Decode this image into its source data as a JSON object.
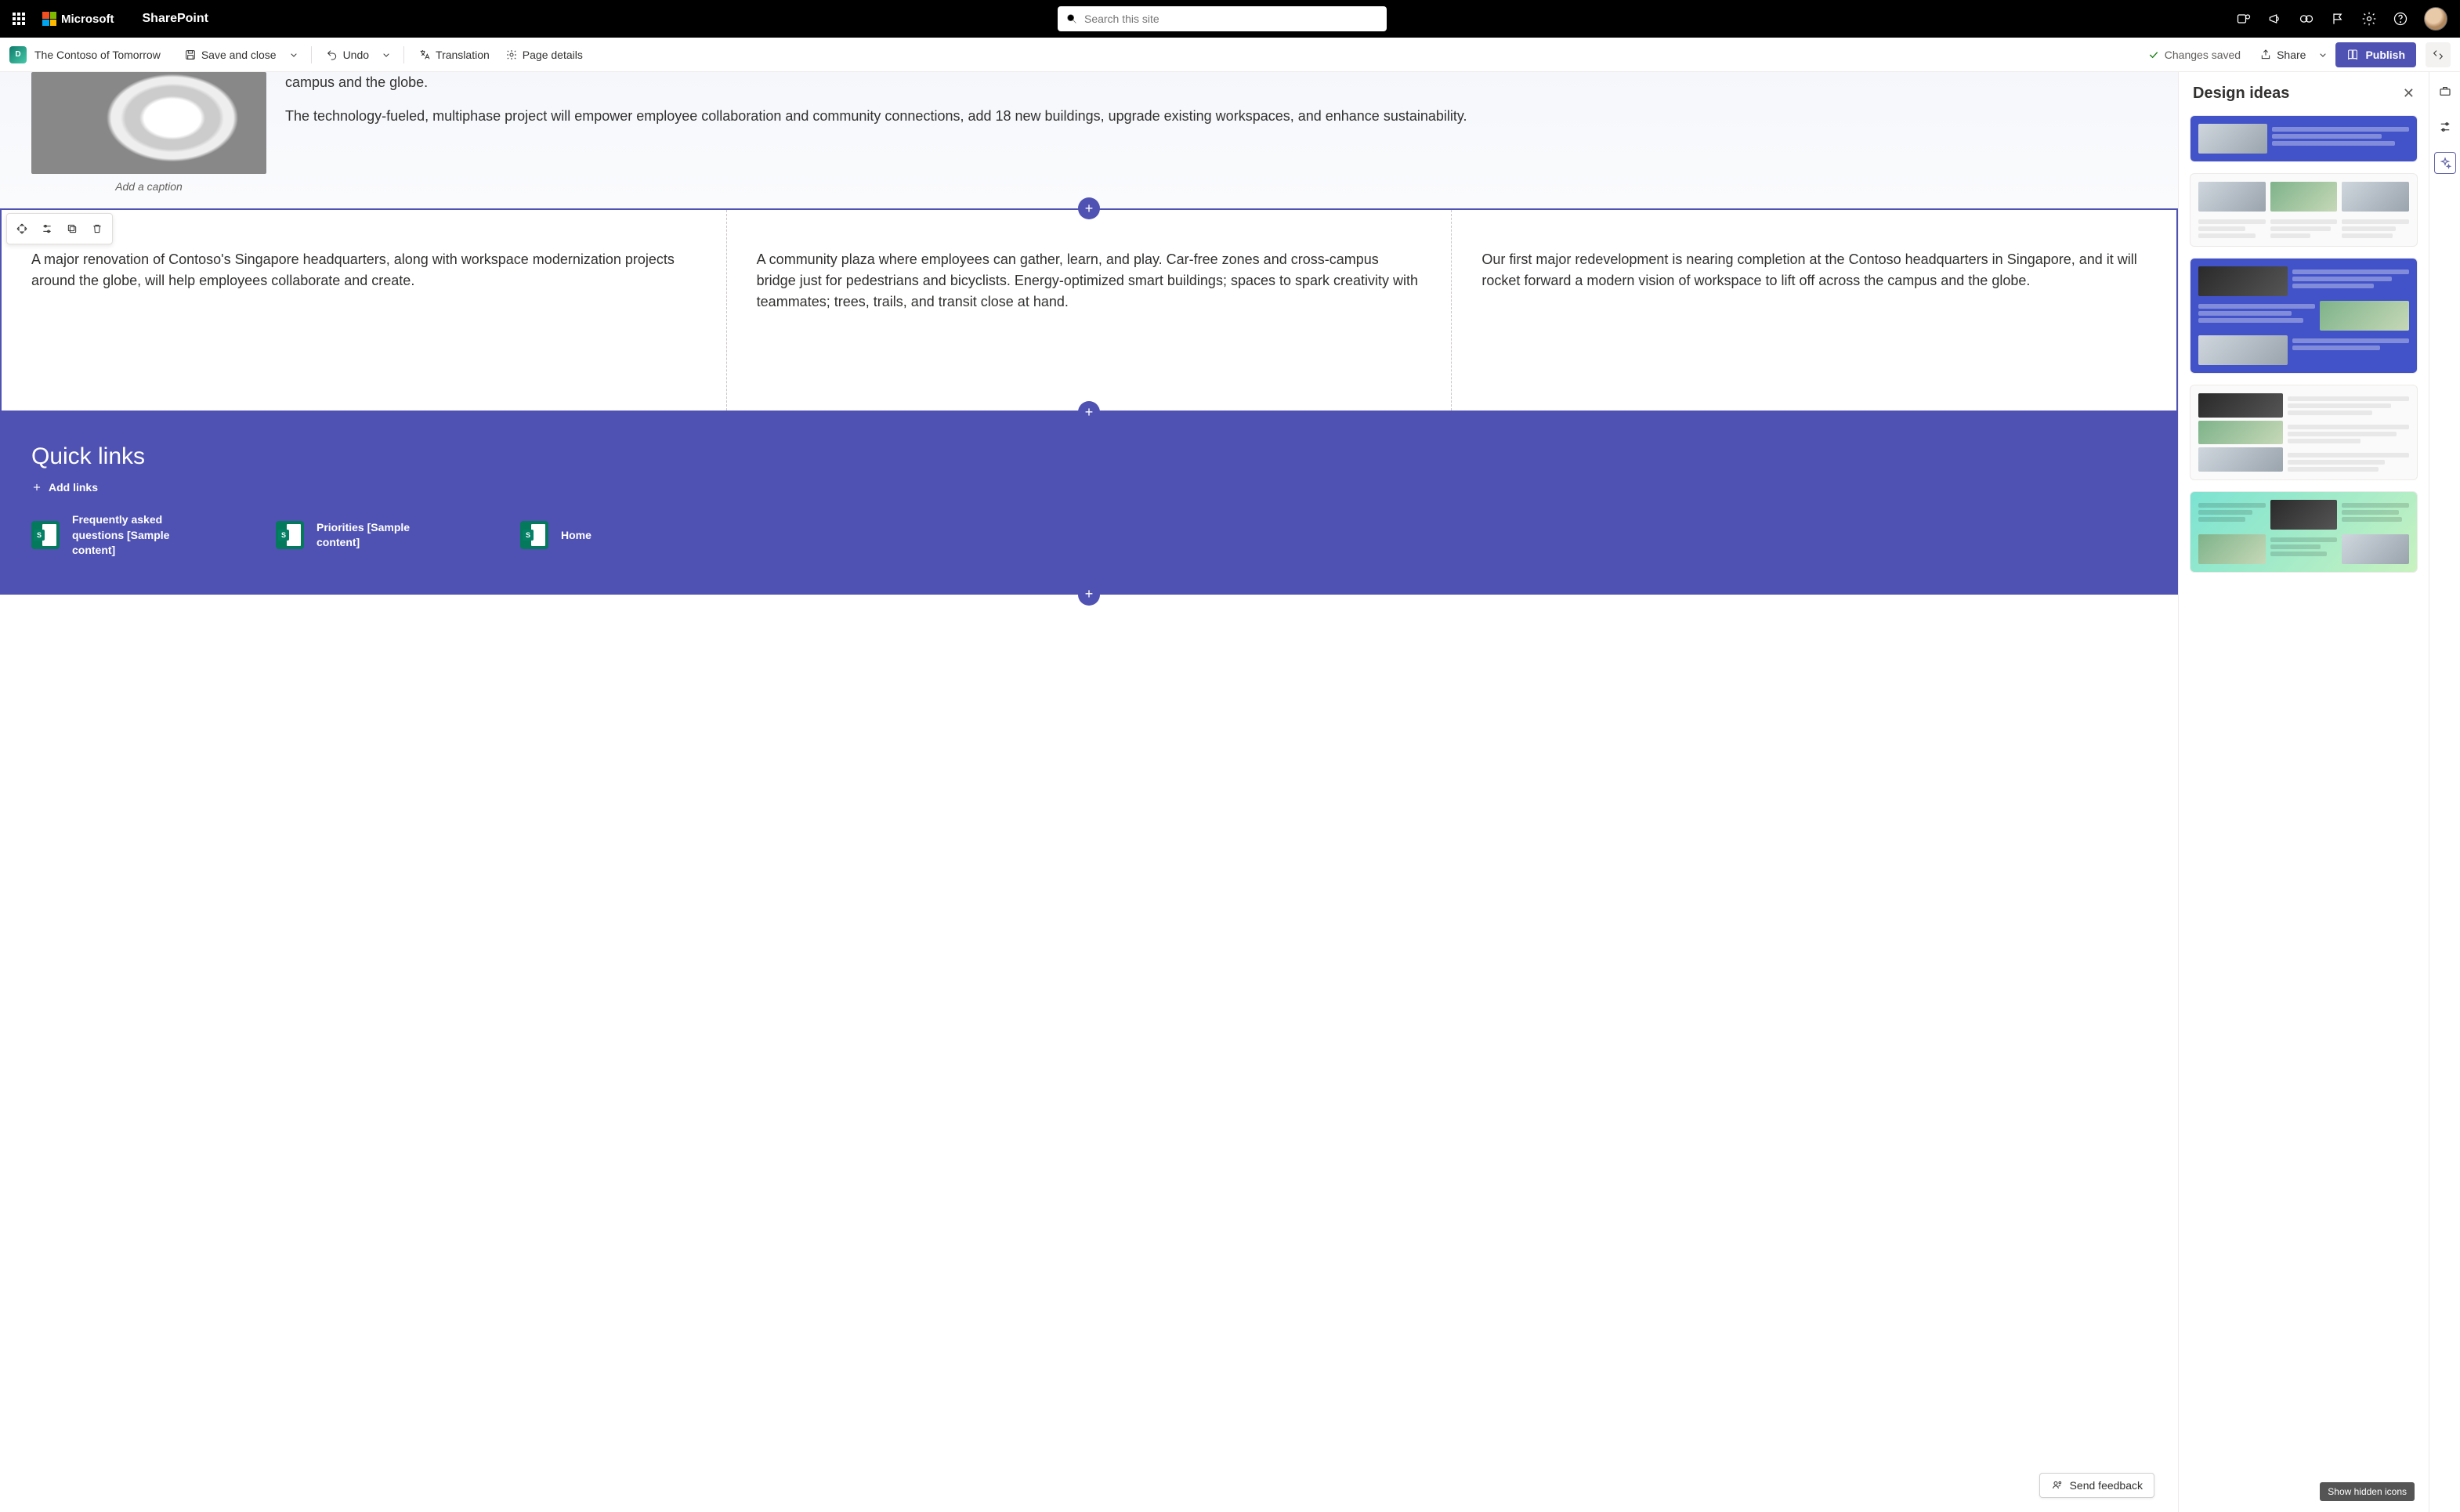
{
  "brand": {
    "company": "Microsoft",
    "app": "SharePoint"
  },
  "search": {
    "placeholder": "Search this site"
  },
  "site": {
    "name": "The Contoso of Tomorrow"
  },
  "commands": {
    "save": "Save and close",
    "undo": "Undo",
    "translate": "Translation",
    "pagedetails": "Page details",
    "status": "Changes saved",
    "share": "Share",
    "publish": "Publish"
  },
  "hero": {
    "caption_placeholder": "Add a caption",
    "partial_line": "campus and the globe.",
    "para2": "The technology-fueled, multiphase project will empower employee collaboration and community connections, add 18 new buildings, upgrade existing workspaces, and enhance sustainability."
  },
  "cols": {
    "c1": "A major renovation of Contoso's Singapore headquarters, along with workspace modernization projects around the globe, will help employees collaborate and create.",
    "c2": "A community plaza where employees can gather, learn, and play. Car-free zones and cross-campus bridge just for pedestrians and bicyclists. Energy-optimized smart buildings; spaces to spark creativity with teammates; trees, trails, and transit close at hand.",
    "c3": "Our first major redevelopment is nearing completion at the Contoso headquarters in Singapore, and it will rocket forward a modern vision of workspace to lift off across the campus and the globe."
  },
  "quicklinks": {
    "title": "Quick links",
    "add": "Add links",
    "items": [
      {
        "label": "Frequently asked questions [Sample content]"
      },
      {
        "label": "Priorities [Sample content]"
      },
      {
        "label": "Home"
      }
    ]
  },
  "feedback": "Send feedback",
  "design": {
    "title": "Design ideas"
  },
  "toast": "Show hidden icons"
}
